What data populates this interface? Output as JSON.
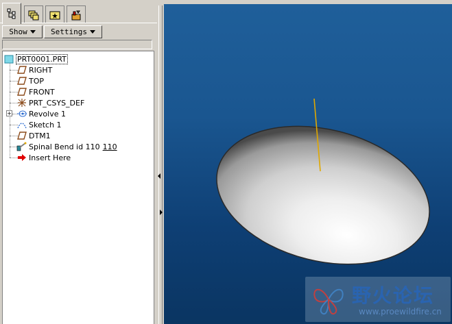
{
  "tabs": [
    {
      "name": "model-tree-tab",
      "icon": "model-tree-icon",
      "active": true
    },
    {
      "name": "layers-tab",
      "icon": "folders-icon",
      "active": false
    },
    {
      "name": "favorites-tab",
      "icon": "star-folder-icon",
      "active": false
    },
    {
      "name": "tools-tab",
      "icon": "tools-icon",
      "active": false
    }
  ],
  "toolbar": {
    "show_label": "Show",
    "settings_label": "Settings"
  },
  "tree": {
    "root": "PRT0001.PRT",
    "items": [
      {
        "label": "RIGHT",
        "icon": "datum-plane-icon"
      },
      {
        "label": "TOP",
        "icon": "datum-plane-icon"
      },
      {
        "label": "FRONT",
        "icon": "datum-plane-icon"
      },
      {
        "label": "PRT_CSYS_DEF",
        "icon": "csys-icon"
      },
      {
        "label": "Revolve 1",
        "icon": "revolve-icon"
      },
      {
        "label": "Sketch 1",
        "icon": "sketch-icon"
      },
      {
        "label": "DTM1",
        "icon": "datum-plane-icon"
      },
      {
        "label": "Spinal Bend id 110",
        "sublabel": "110",
        "icon": "spinal-bend-icon"
      },
      {
        "label": "Insert Here",
        "icon": "insert-arrow-icon"
      }
    ]
  },
  "watermark": {
    "title": "野火论坛",
    "url": "www.proewildfire.cn"
  },
  "colors": {
    "viewport_top": "#1f5f9a",
    "viewport_bottom": "#0a3562",
    "datum_plane": "#8b4a1a",
    "axis_line": "#e0a800",
    "insert_arrow": "#e00000"
  }
}
